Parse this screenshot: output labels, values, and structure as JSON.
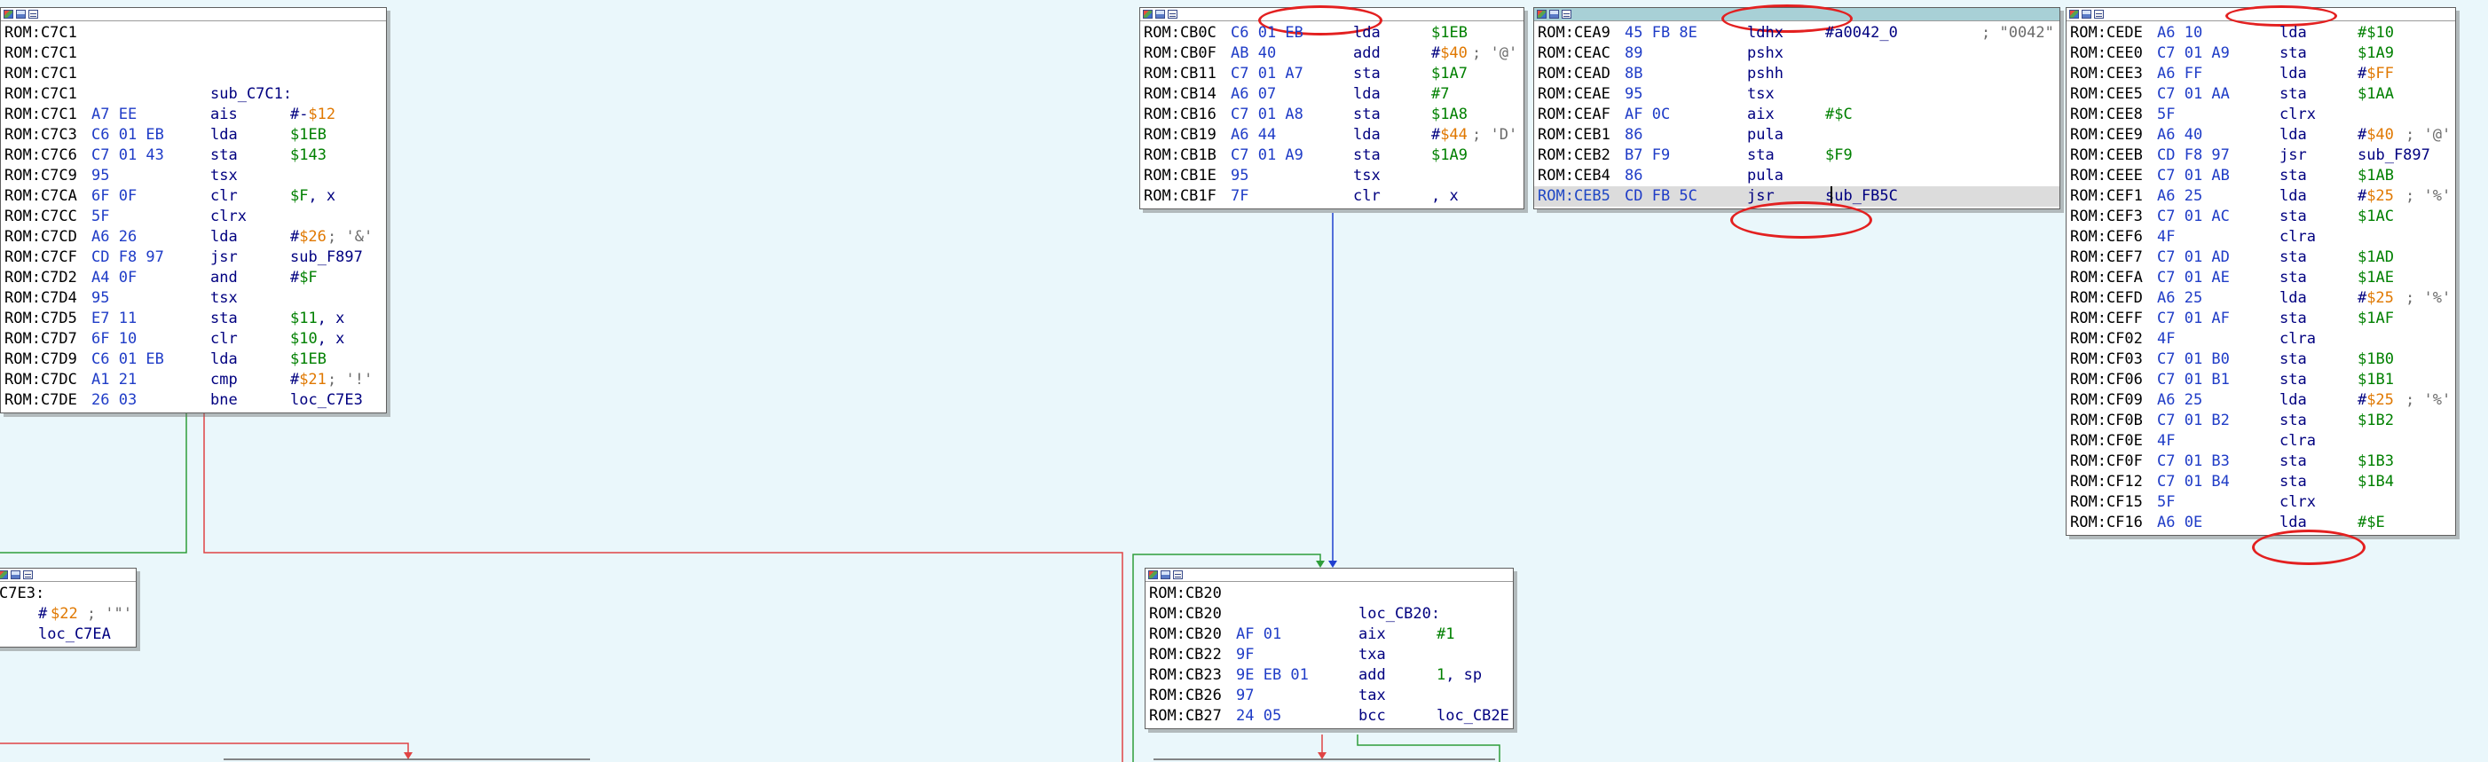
{
  "colors": {
    "background": "#eaf7fb",
    "edge_true": "#2e9e3a",
    "edge_false": "#e04444",
    "edge_uncond": "#2040d0",
    "annotation": "#e32020"
  },
  "blocks": [
    {
      "id": "block_sub_C7C1",
      "lines": [
        {
          "addr": "ROM:C7C1"
        },
        {
          "addr": "ROM:C7C1"
        },
        {
          "addr": "ROM:C7C1"
        },
        {
          "addr": "ROM:C7C1",
          "label": "sub_C7C1:"
        },
        {
          "addr": "ROM:C7C1",
          "bytes": "A7 EE",
          "mn": "ais",
          "op": [
            [
              "#-",
              "op"
            ],
            [
              "$12",
              "imm"
            ]
          ]
        },
        {
          "addr": "ROM:C7C3",
          "bytes": "C6 01 EB",
          "mn": "lda",
          "op": [
            [
              "$1EB",
              "num"
            ]
          ]
        },
        {
          "addr": "ROM:C7C6",
          "bytes": "C7 01 43",
          "mn": "sta",
          "op": [
            [
              "$143",
              "num"
            ]
          ]
        },
        {
          "addr": "ROM:C7C9",
          "bytes": "95",
          "mn": "tsx"
        },
        {
          "addr": "ROM:C7CA",
          "bytes": "6F 0F",
          "mn": "clr",
          "op": [
            [
              "$F",
              "num"
            ],
            [
              ", x",
              "op"
            ]
          ]
        },
        {
          "addr": "ROM:C7CC",
          "bytes": "5F",
          "mn": "clrx"
        },
        {
          "addr": "ROM:C7CD",
          "bytes": "A6 26",
          "mn": "lda",
          "op": [
            [
              "#",
              "op"
            ],
            [
              "$26",
              "imm"
            ]
          ],
          "cmt": "; '&'"
        },
        {
          "addr": "ROM:C7CF",
          "bytes": "CD F8 97",
          "mn": "jsr",
          "op": [
            [
              "sub_F897",
              "op"
            ]
          ]
        },
        {
          "addr": "ROM:C7D2",
          "bytes": "A4 0F",
          "mn": "and",
          "op": [
            [
              "#",
              "op"
            ],
            [
              "$F",
              "num"
            ]
          ]
        },
        {
          "addr": "ROM:C7D4",
          "bytes": "95",
          "mn": "tsx"
        },
        {
          "addr": "ROM:C7D5",
          "bytes": "E7 11",
          "mn": "sta",
          "op": [
            [
              "$11",
              "num"
            ],
            [
              ", x",
              "op"
            ]
          ]
        },
        {
          "addr": "ROM:C7D7",
          "bytes": "6F 10",
          "mn": "clr",
          "op": [
            [
              "$10",
              "num"
            ],
            [
              ", x",
              "op"
            ]
          ]
        },
        {
          "addr": "ROM:C7D9",
          "bytes": "C6 01 EB",
          "mn": "lda",
          "op": [
            [
              "$1EB",
              "num"
            ]
          ]
        },
        {
          "addr": "ROM:C7DC",
          "bytes": "A1 21",
          "mn": "cmp",
          "op": [
            [
              "#",
              "op"
            ],
            [
              "$21",
              "imm"
            ]
          ],
          "cmt": "; '!'"
        },
        {
          "addr": "ROM:C7DE",
          "bytes": "26 03",
          "mn": "bne",
          "op": [
            [
              "loc_C7E3",
              "op"
            ]
          ]
        }
      ]
    },
    {
      "id": "block_loc_C7E3",
      "lines": [
        {
          "addr": "C7E3:"
        },
        {
          "addr": "",
          "mn": "#",
          "op": [
            [
              "$22",
              "imm"
            ],
            [
              " ; '\"'",
              "cmt"
            ]
          ]
        },
        {
          "addr": "",
          "mn": "loc_C7EA"
        }
      ]
    },
    {
      "id": "block_CB0C",
      "lines": [
        {
          "addr": "ROM:CB0C",
          "bytes": "C6 01 EB",
          "mn": "lda",
          "op": [
            [
              "$1EB",
              "num"
            ]
          ]
        },
        {
          "addr": "ROM:CB0F",
          "bytes": "AB 40",
          "mn": "add",
          "op": [
            [
              "#",
              "op"
            ],
            [
              "$40",
              "imm"
            ]
          ],
          "cmt": "; '@'"
        },
        {
          "addr": "ROM:CB11",
          "bytes": "C7 01 A7",
          "mn": "sta",
          "op": [
            [
              "$1A7",
              "num"
            ]
          ]
        },
        {
          "addr": "ROM:CB14",
          "bytes": "A6 07",
          "mn": "lda",
          "op": [
            [
              "#7",
              "num"
            ]
          ]
        },
        {
          "addr": "ROM:CB16",
          "bytes": "C7 01 A8",
          "mn": "sta",
          "op": [
            [
              "$1A8",
              "num"
            ]
          ]
        },
        {
          "addr": "ROM:CB19",
          "bytes": "A6 44",
          "mn": "lda",
          "op": [
            [
              "#",
              "op"
            ],
            [
              "$44",
              "imm"
            ]
          ],
          "cmt": "; 'D'"
        },
        {
          "addr": "ROM:CB1B",
          "bytes": "C7 01 A9",
          "mn": "sta",
          "op": [
            [
              "$1A9",
              "num"
            ]
          ]
        },
        {
          "addr": "ROM:CB1E",
          "bytes": "95",
          "mn": "tsx"
        },
        {
          "addr": "ROM:CB1F",
          "bytes": "7F",
          "mn": "clr",
          "op": [
            [
              ", x",
              "op"
            ]
          ]
        }
      ]
    },
    {
      "id": "block_CEA9",
      "lines": [
        {
          "addr": "ROM:CEA9",
          "bytes": "45 FB 8E",
          "mn": "ldhx",
          "op": [
            [
              "#a0042_0",
              "op"
            ]
          ],
          "cmt": "; \"0042\""
        },
        {
          "addr": "ROM:CEAC",
          "bytes": "89",
          "mn": "pshx"
        },
        {
          "addr": "ROM:CEAD",
          "bytes": "8B",
          "mn": "pshh"
        },
        {
          "addr": "ROM:CEAE",
          "bytes": "95",
          "mn": "tsx"
        },
        {
          "addr": "ROM:CEAF",
          "bytes": "AF 0C",
          "mn": "aix",
          "op": [
            [
              "#$C",
              "num"
            ]
          ]
        },
        {
          "addr": "ROM:CEB1",
          "bytes": "86",
          "mn": "pula"
        },
        {
          "addr": "ROM:CEB2",
          "bytes": "B7 F9",
          "mn": "sta",
          "op": [
            [
              "$F9",
              "num"
            ]
          ]
        },
        {
          "addr": "ROM:CEB4",
          "bytes": "86",
          "mn": "pula"
        },
        {
          "addr": "ROM:CEB5",
          "bytes": "CD FB 5C",
          "mn": "jsr",
          "op": [
            [
              "sub_FB5C",
              "op"
            ]
          ]
        }
      ]
    },
    {
      "id": "block_CEDE",
      "lines": [
        {
          "addr": "ROM:CEDE",
          "bytes": "A6 10",
          "mn": "lda",
          "op": [
            [
              "#$10",
              "num"
            ]
          ]
        },
        {
          "addr": "ROM:CEE0",
          "bytes": "C7 01 A9",
          "mn": "sta",
          "op": [
            [
              "$1A9",
              "num"
            ]
          ]
        },
        {
          "addr": "ROM:CEE3",
          "bytes": "A6 FF",
          "mn": "lda",
          "op": [
            [
              "#",
              "op"
            ],
            [
              "$FF",
              "imm"
            ]
          ]
        },
        {
          "addr": "ROM:CEE5",
          "bytes": "C7 01 AA",
          "mn": "sta",
          "op": [
            [
              "$1AA",
              "num"
            ]
          ]
        },
        {
          "addr": "ROM:CEE8",
          "bytes": "5F",
          "mn": "clrx"
        },
        {
          "addr": "ROM:CEE9",
          "bytes": "A6 40",
          "mn": "lda",
          "op": [
            [
              "#",
              "op"
            ],
            [
              "$40",
              "imm"
            ]
          ],
          "cmt": "; '@'"
        },
        {
          "addr": "ROM:CEEB",
          "bytes": "CD F8 97",
          "mn": "jsr",
          "op": [
            [
              "sub_F897",
              "op"
            ]
          ]
        },
        {
          "addr": "ROM:CEEE",
          "bytes": "C7 01 AB",
          "mn": "sta",
          "op": [
            [
              "$1AB",
              "num"
            ]
          ]
        },
        {
          "addr": "ROM:CEF1",
          "bytes": "A6 25",
          "mn": "lda",
          "op": [
            [
              "#",
              "op"
            ],
            [
              "$25",
              "imm"
            ]
          ],
          "cmt": "; '%'"
        },
        {
          "addr": "ROM:CEF3",
          "bytes": "C7 01 AC",
          "mn": "sta",
          "op": [
            [
              "$1AC",
              "num"
            ]
          ]
        },
        {
          "addr": "ROM:CEF6",
          "bytes": "4F",
          "mn": "clra"
        },
        {
          "addr": "ROM:CEF7",
          "bytes": "C7 01 AD",
          "mn": "sta",
          "op": [
            [
              "$1AD",
              "num"
            ]
          ]
        },
        {
          "addr": "ROM:CEFA",
          "bytes": "C7 01 AE",
          "mn": "sta",
          "op": [
            [
              "$1AE",
              "num"
            ]
          ]
        },
        {
          "addr": "ROM:CEFD",
          "bytes": "A6 25",
          "mn": "lda",
          "op": [
            [
              "#",
              "op"
            ],
            [
              "$25",
              "imm"
            ]
          ],
          "cmt": "; '%'"
        },
        {
          "addr": "ROM:CEFF",
          "bytes": "C7 01 AF",
          "mn": "sta",
          "op": [
            [
              "$1AF",
              "num"
            ]
          ]
        },
        {
          "addr": "ROM:CF02",
          "bytes": "4F",
          "mn": "clra"
        },
        {
          "addr": "ROM:CF03",
          "bytes": "C7 01 B0",
          "mn": "sta",
          "op": [
            [
              "$1B0",
              "num"
            ]
          ]
        },
        {
          "addr": "ROM:CF06",
          "bytes": "C7 01 B1",
          "mn": "sta",
          "op": [
            [
              "$1B1",
              "num"
            ]
          ]
        },
        {
          "addr": "ROM:CF09",
          "bytes": "A6 25",
          "mn": "lda",
          "op": [
            [
              "#",
              "op"
            ],
            [
              "$25",
              "imm"
            ]
          ],
          "cmt": "; '%'"
        },
        {
          "addr": "ROM:CF0B",
          "bytes": "C7 01 B2",
          "mn": "sta",
          "op": [
            [
              "$1B2",
              "num"
            ]
          ]
        },
        {
          "addr": "ROM:CF0E",
          "bytes": "4F",
          "mn": "clra"
        },
        {
          "addr": "ROM:CF0F",
          "bytes": "C7 01 B3",
          "mn": "sta",
          "op": [
            [
              "$1B3",
              "num"
            ]
          ]
        },
        {
          "addr": "ROM:CF12",
          "bytes": "C7 01 B4",
          "mn": "sta",
          "op": [
            [
              "$1B4",
              "num"
            ]
          ]
        },
        {
          "addr": "ROM:CF15",
          "bytes": "5F",
          "mn": "clrx"
        },
        {
          "addr": "ROM:CF16",
          "bytes": "A6 0E",
          "mn": "lda",
          "op": [
            [
              "#$E",
              "num"
            ]
          ]
        }
      ]
    },
    {
      "id": "block_loc_CB20",
      "lines": [
        {
          "addr": "ROM:CB20"
        },
        {
          "addr": "ROM:CB20",
          "label": "loc_CB20:"
        },
        {
          "addr": "ROM:CB20",
          "bytes": "AF 01",
          "mn": "aix",
          "op": [
            [
              "#1",
              "num"
            ]
          ]
        },
        {
          "addr": "ROM:CB22",
          "bytes": "9F",
          "mn": "txa"
        },
        {
          "addr": "ROM:CB23",
          "bytes": "9E EB 01",
          "mn": "add",
          "op": [
            [
              "1",
              "num"
            ],
            [
              ", sp",
              "op"
            ]
          ]
        },
        {
          "addr": "ROM:CB26",
          "bytes": "97",
          "mn": "tax"
        },
        {
          "addr": "ROM:CB27",
          "bytes": "24 05",
          "mn": "bcc",
          "op": [
            [
              "loc_CB2E",
              "op"
            ]
          ]
        }
      ]
    }
  ]
}
